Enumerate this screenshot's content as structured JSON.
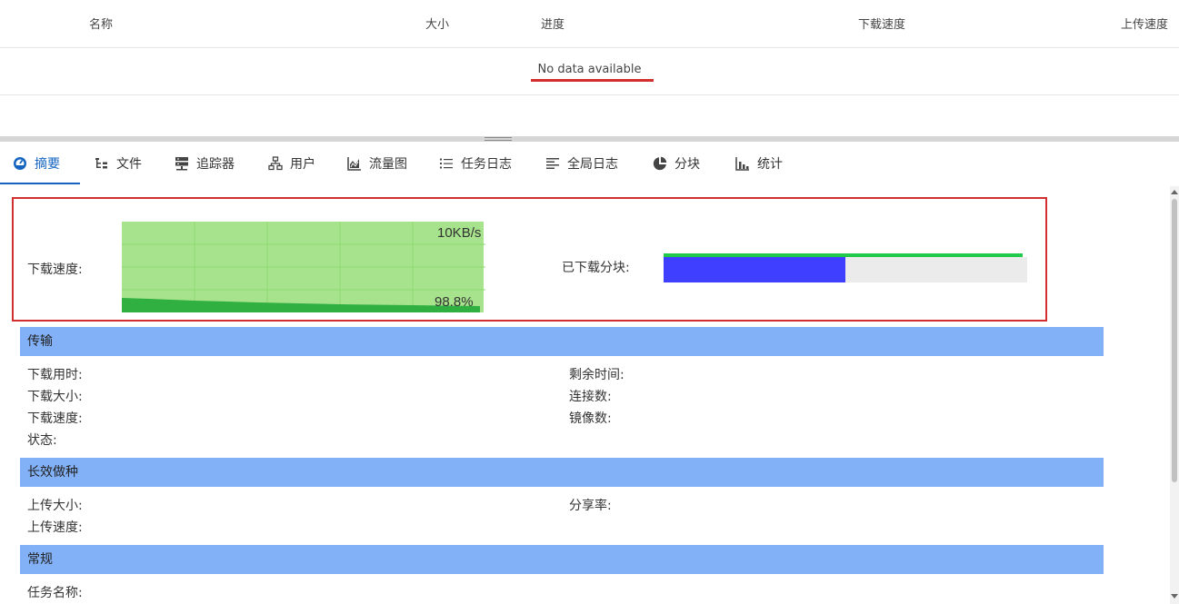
{
  "table": {
    "columns": [
      "名称",
      "大小",
      "进度",
      "下载速度",
      "上传速度"
    ],
    "empty_text": "No data available"
  },
  "tabs": [
    {
      "label": "摘要",
      "icon": "dashboard-icon",
      "active": true
    },
    {
      "label": "文件",
      "icon": "file-tree-icon",
      "active": false
    },
    {
      "label": "追踪器",
      "icon": "server-icon",
      "active": false
    },
    {
      "label": "用户",
      "icon": "network-icon",
      "active": false
    },
    {
      "label": "流量图",
      "icon": "area-chart-icon",
      "active": false
    },
    {
      "label": "任务日志",
      "icon": "list-icon",
      "active": false
    },
    {
      "label": "全局日志",
      "icon": "align-left-icon",
      "active": false
    },
    {
      "label": "分块",
      "icon": "pie-icon",
      "active": false
    },
    {
      "label": "统计",
      "icon": "bar-chart-icon",
      "active": false
    }
  ],
  "summary": {
    "speed_label": "下载速度:",
    "graph_max": "10KB/s",
    "graph_percent": "98.8%",
    "pieces_label": "已下载分块:",
    "pieces_progress": 0.5
  },
  "sections": {
    "transfer": {
      "title": "传输",
      "download_time": "下载用时:",
      "download_size": "下载大小:",
      "download_speed": "下载速度:",
      "status": "状态:",
      "remaining_time": "剩余时间:",
      "connections": "连接数:",
      "mirrors": "镜像数:"
    },
    "seeding": {
      "title": "长效做种",
      "upload_size": "上传大小:",
      "upload_speed": "上传速度:",
      "share_ratio": "分享率:"
    },
    "general": {
      "title": "常规",
      "task_name": "任务名称:"
    }
  },
  "colors": {
    "accent": "#1565c0",
    "highlight_border": "#d32f2f",
    "section_header": "#82b1f7",
    "graph_bg": "#a6e38c",
    "graph_fill": "#30b040",
    "pieces_fill": "#3f3fff",
    "pieces_top": "#21c94a"
  }
}
